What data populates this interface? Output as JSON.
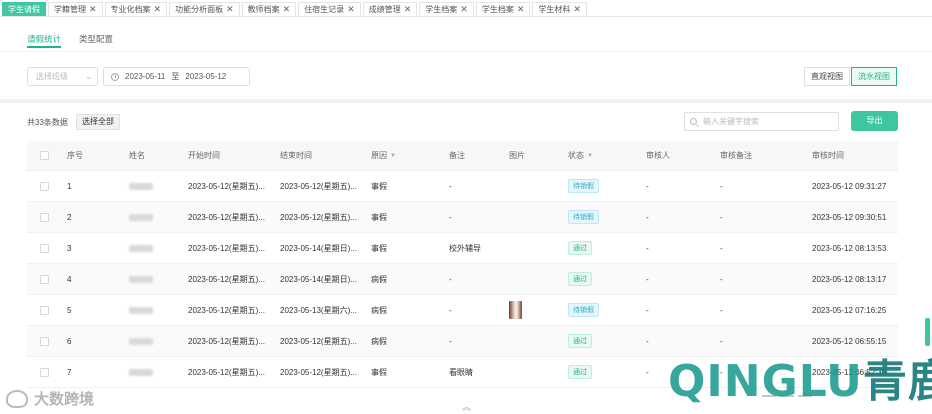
{
  "top_tabs": [
    {
      "label": "学生请假",
      "active": true,
      "closable": false
    },
    {
      "label": "学籍管理",
      "active": false,
      "closable": true
    },
    {
      "label": "专业化档案",
      "active": false,
      "closable": true
    },
    {
      "label": "功能分析面板",
      "active": false,
      "closable": true
    },
    {
      "label": "教师档案",
      "active": false,
      "closable": true
    },
    {
      "label": "住宿生记录",
      "active": false,
      "closable": true
    },
    {
      "label": "成绩管理",
      "active": false,
      "closable": true
    },
    {
      "label": "学生档案",
      "active": false,
      "closable": true
    },
    {
      "label": "学生档案",
      "active": false,
      "closable": true
    },
    {
      "label": "学生材料",
      "active": false,
      "closable": true
    }
  ],
  "sub_tabs": {
    "stats": "请假统计",
    "config": "类型配置"
  },
  "filters": {
    "select_placeholder": "选择班级",
    "date_start": "2023-05-11",
    "date_sep": "至",
    "date_end": "2023-05-12",
    "view_visual": "直观视图",
    "view_flow": "流水视图"
  },
  "toolbar": {
    "count_text": "共33条数据",
    "select_all": "选择全部",
    "search_placeholder": "输入关键字搜索",
    "export": "导出"
  },
  "table": {
    "headers": {
      "index": "序号",
      "name": "姓名",
      "start": "开始时间",
      "end": "结束时间",
      "reason": "原因",
      "remark": "备注",
      "image": "图片",
      "status": "状态",
      "reviewer": "审核人",
      "review_remark": "审核备注",
      "review_time": "审核时间"
    },
    "rows": [
      {
        "index": "1",
        "start": "2023-05-12(星期五)...",
        "end": "2023-05-12(星期五)...",
        "reason": "事假",
        "remark": "-",
        "has_image": false,
        "status": "待销假",
        "reviewer": "-",
        "review_remark": "-",
        "review_time": "2023-05-12 09:31:27"
      },
      {
        "index": "2",
        "start": "2023-05-12(星期五)...",
        "end": "2023-05-12(星期五)...",
        "reason": "事假",
        "remark": "-",
        "has_image": false,
        "status": "待销假",
        "reviewer": "-",
        "review_remark": "-",
        "review_time": "2023-05-12 09:30:51"
      },
      {
        "index": "3",
        "start": "2023-05-12(星期五)...",
        "end": "2023-05-14(星期日)...",
        "reason": "事假",
        "remark": "校外辅导",
        "has_image": false,
        "status": "通过",
        "reviewer": "-",
        "review_remark": "-",
        "review_time": "2023-05-12 08:13:53"
      },
      {
        "index": "4",
        "start": "2023-05-12(星期五)...",
        "end": "2023-05-14(星期日)...",
        "reason": "病假",
        "remark": "-",
        "has_image": false,
        "status": "通过",
        "reviewer": "-",
        "review_remark": "-",
        "review_time": "2023-05-12 08:13:17"
      },
      {
        "index": "5",
        "start": "2023-05-12(星期五)...",
        "end": "2023-05-13(星期六)...",
        "reason": "病假",
        "remark": "-",
        "has_image": true,
        "status": "待销假",
        "reviewer": "-",
        "review_remark": "-",
        "review_time": "2023-05-12 07:16:25"
      },
      {
        "index": "6",
        "start": "2023-05-12(星期五)...",
        "end": "2023-05-12(星期五)...",
        "reason": "病假",
        "remark": "-",
        "has_image": false,
        "status": "通过",
        "reviewer": "-",
        "review_remark": "-",
        "review_time": "2023-05-12 06:55:15"
      },
      {
        "index": "7",
        "start": "2023-05-12(星期五)...",
        "end": "2023-05-12(星期五)...",
        "reason": "事假",
        "remark": "看眼睛",
        "has_image": false,
        "status": "通过",
        "reviewer": "-",
        "review_remark": "-",
        "review_time": "2023-05-12 06:52:30"
      }
    ]
  },
  "status_colors": {
    "待销假": {
      "fg": "#2aa8c8",
      "bg": "#e6f7fb",
      "border": "#bfe8f2"
    },
    "通过": {
      "fg": "#2bb58c",
      "bg": "#e8f8f2",
      "border": "#bfeedd"
    }
  },
  "icons": {
    "sort": "sort-caret-down-icon",
    "collapse": "double-chevron-up-icon"
  },
  "watermarks": {
    "left": "大数跨境",
    "right_latin": "QINGLU",
    "right_cn": "青鹿"
  }
}
